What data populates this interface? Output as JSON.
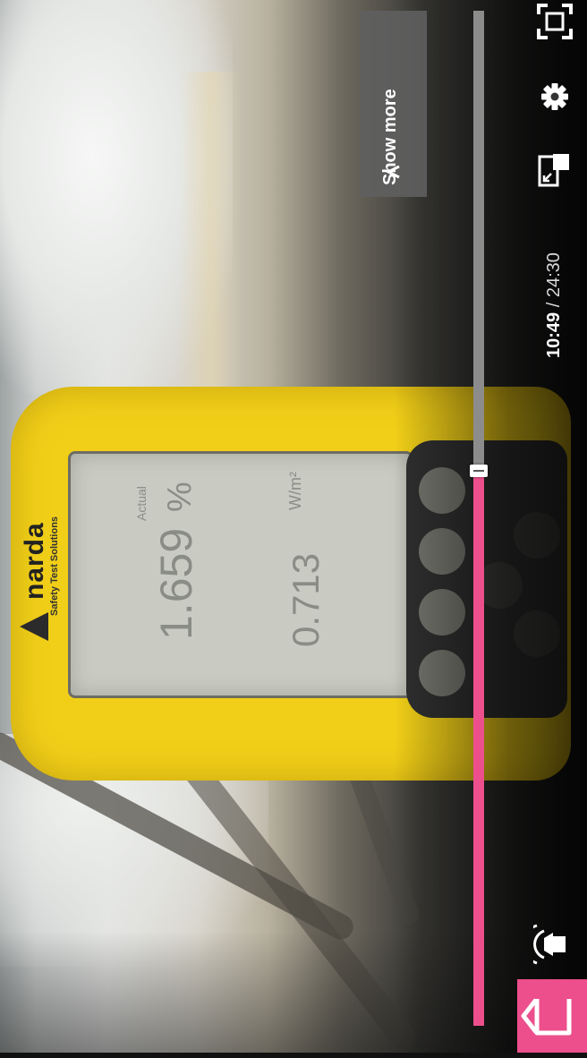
{
  "player": {
    "current_time": "10:49",
    "separator": " / ",
    "total_time": "24:30",
    "progress_fraction": 0.547,
    "accent_color": "#ec4f8c",
    "show_more_label": "Show more"
  },
  "video_content": {
    "brand_name": "narda",
    "brand_tagline": "Safety Test Solutions",
    "reading_percent": "1.659",
    "reading_percent_unit": "%",
    "reading_mode": "Actual",
    "reading_power": "0.713",
    "reading_power_unit": "W/m²"
  },
  "icons": {
    "fullscreen": "fullscreen-icon",
    "settings": "gear-icon",
    "miniplayer": "miniplayer-icon",
    "cast": "cast-icon",
    "home": "home-icon",
    "show_more_caret": "chevron-up-icon"
  }
}
